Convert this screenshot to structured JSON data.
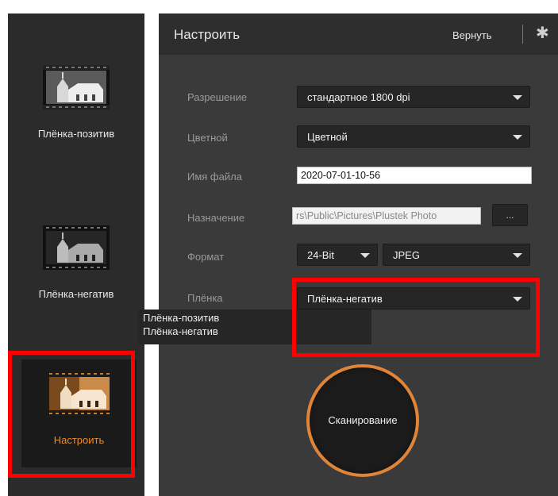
{
  "sidebar": {
    "modes": [
      {
        "label": "Плёнка-позитив",
        "icon": "film-positive-icon"
      },
      {
        "label": "Плёнка-негатив",
        "icon": "film-negative-icon"
      },
      {
        "label": "Настроить",
        "icon": "custom-settings-icon"
      }
    ]
  },
  "header": {
    "title": "Настроить",
    "reset_label": "Вернуть",
    "settings_icon": "gear-icon"
  },
  "form": {
    "resolution": {
      "label": "Разрешение",
      "value": "стандартное 1800 dpi"
    },
    "color": {
      "label": "Цветной",
      "value": "Цветной"
    },
    "filename": {
      "label": "Имя файла",
      "value": "2020-07-01-10-56"
    },
    "destination": {
      "label": "Назначение",
      "value": "rs\\Public\\Pictures\\Plustek Photo",
      "browse_label": "..."
    },
    "format": {
      "label": "Формат",
      "bitdepth": "24-Bit",
      "type": "JPEG"
    },
    "film": {
      "label": "Плёнка",
      "value": "Плёнка-негатив",
      "options": [
        "Плёнка-позитив",
        "Плёнка-негатив"
      ]
    }
  },
  "scan_label": "Сканирование",
  "colors": {
    "accent": "#f08a24",
    "highlight": "#ff0000",
    "panel": "#3a3a3a"
  }
}
